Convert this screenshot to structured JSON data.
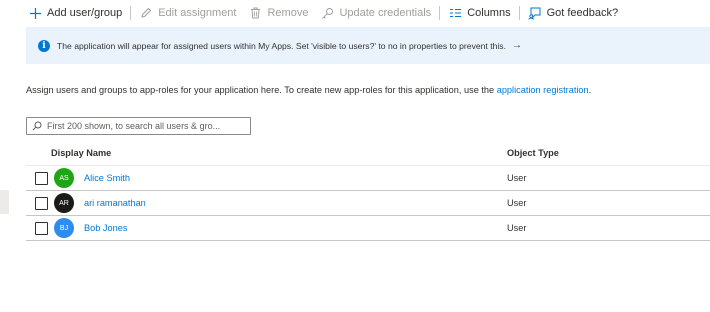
{
  "toolbar": {
    "add_label": "Add user/group",
    "edit_label": "Edit assignment",
    "remove_label": "Remove",
    "update_label": "Update credentials",
    "columns_label": "Columns",
    "feedback_label": "Got feedback?"
  },
  "banner": {
    "text": "The application will appear for assigned users within My Apps. Set 'visible to users?' to no in properties to prevent this.",
    "arrow": "→"
  },
  "description": {
    "text": "Assign users and groups to app-roles for your application here. To create new app-roles for this application, use the ",
    "link": "application registration",
    "suffix": "."
  },
  "search": {
    "placeholder": "First 200 shown, to search all users & gro..."
  },
  "table": {
    "columns": [
      "Display Name",
      "Object Type"
    ],
    "rows": [
      {
        "initials": "AS",
        "name": "Alice Smith",
        "type": "User",
        "avatar_color": "#1ea614"
      },
      {
        "initials": "AR",
        "name": "ari ramanathan",
        "type": "User",
        "avatar_color": "#1b1a19"
      },
      {
        "initials": "BJ",
        "name": "Bob Jones",
        "type": "User",
        "avatar_color": "#2d8cf0"
      }
    ]
  },
  "colors": {
    "accent": "#0078d4",
    "banner_bg": "#eaf3fc",
    "disabled": "#a19f9d"
  },
  "icons": [
    "plus-icon",
    "pencil-icon",
    "trash-icon",
    "key-icon",
    "columns-icon",
    "feedback-icon",
    "info-icon",
    "search-icon"
  ]
}
